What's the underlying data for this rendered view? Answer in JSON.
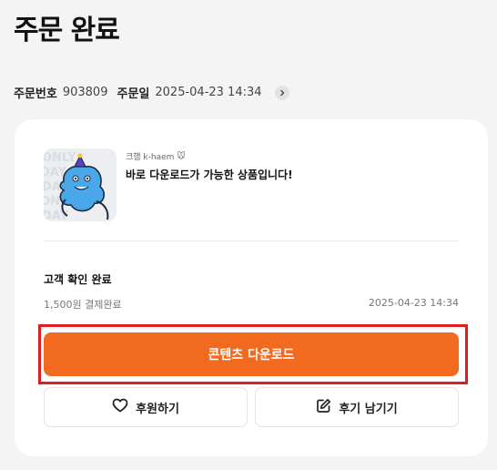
{
  "header": {
    "title": "주문 완료"
  },
  "order": {
    "number_label": "주문번호",
    "number_value": "903809",
    "date_label": "주문일",
    "date_value": "2025-04-23 14:34"
  },
  "product": {
    "creator": "크햄 k-haem",
    "creator_emoji": "🐭",
    "name": "바로 다운로드가 가능한 상품입니다!"
  },
  "purchase": {
    "status": "고객 확인 완료",
    "payment": "1,500원 결제완료",
    "date": "2025-04-23 14:34"
  },
  "actions": {
    "download_label": "콘텐츠 다운로드",
    "support_label": "후원하기",
    "review_label": "후기 남기기"
  },
  "colors": {
    "accent": "#f26a1f",
    "highlight_border": "#e11d1d",
    "background": "#f4f4f5",
    "card": "#ffffff"
  },
  "icons": {
    "meta": "chevron-right-icon",
    "support": "heart-icon",
    "review": "pencil-edit-icon"
  }
}
